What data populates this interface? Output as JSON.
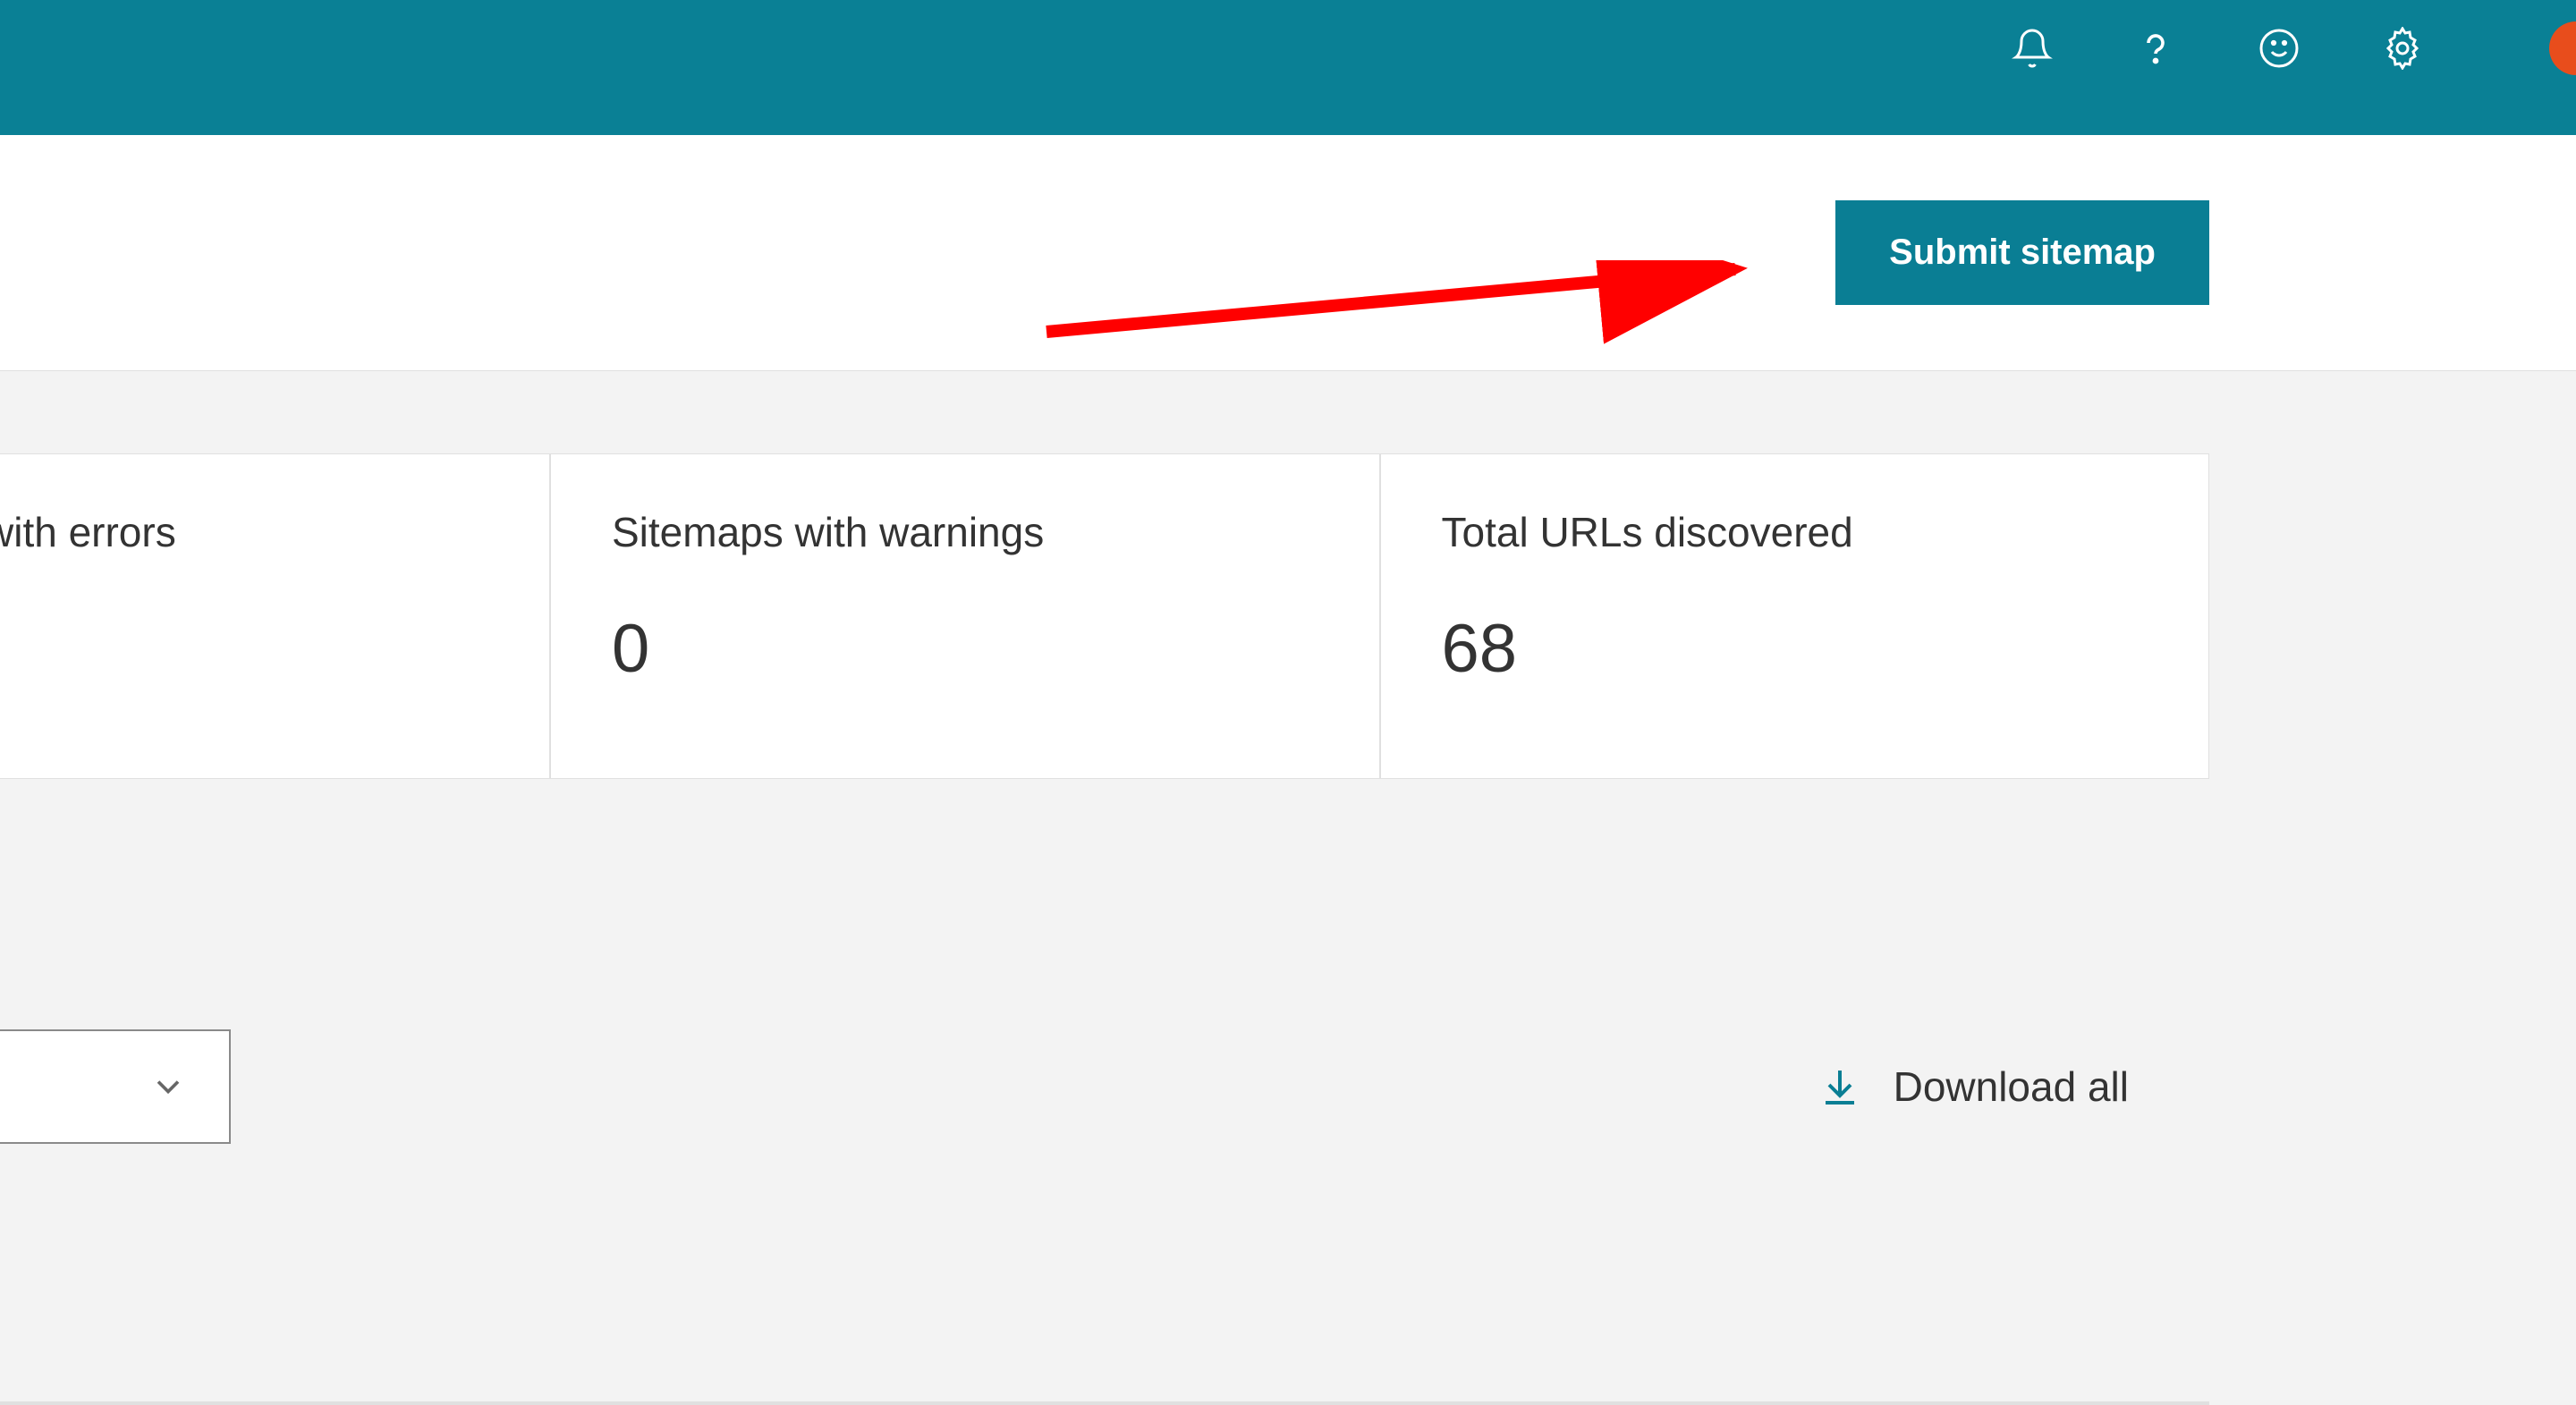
{
  "header": {
    "icons": {
      "bell": "bell-icon",
      "help": "help-icon",
      "feedback": "feedback-icon",
      "settings": "settings-icon"
    }
  },
  "toolbar": {
    "submit_label": "Submit sitemap"
  },
  "stats": {
    "card1": {
      "label": "with errors"
    },
    "card2": {
      "label": "Sitemaps with warnings",
      "value": "0"
    },
    "card3": {
      "label": "Total URLs discovered",
      "value": "68"
    }
  },
  "footer": {
    "download_label": "Download all"
  },
  "colors": {
    "primary": "#0a8095",
    "button": "#0a7e94",
    "arrow": "#ff0000",
    "avatar": "#e84d1c"
  }
}
